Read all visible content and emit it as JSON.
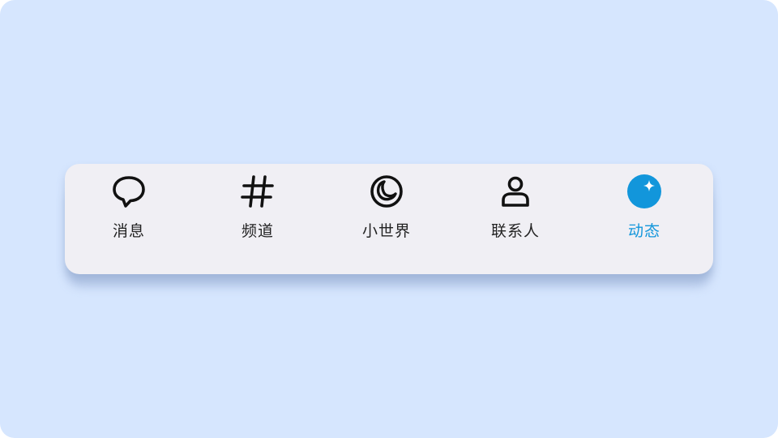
{
  "tabbar": {
    "active_index": 4,
    "accent_color": "#1296db",
    "items": [
      {
        "label": "消息",
        "icon": "chat-bubble-icon"
      },
      {
        "label": "频道",
        "icon": "hashtag-icon"
      },
      {
        "label": "小世界",
        "icon": "planet-ring-icon"
      },
      {
        "label": "联系人",
        "icon": "person-icon"
      },
      {
        "label": "动态",
        "icon": "sparkle-circle-icon"
      }
    ]
  }
}
